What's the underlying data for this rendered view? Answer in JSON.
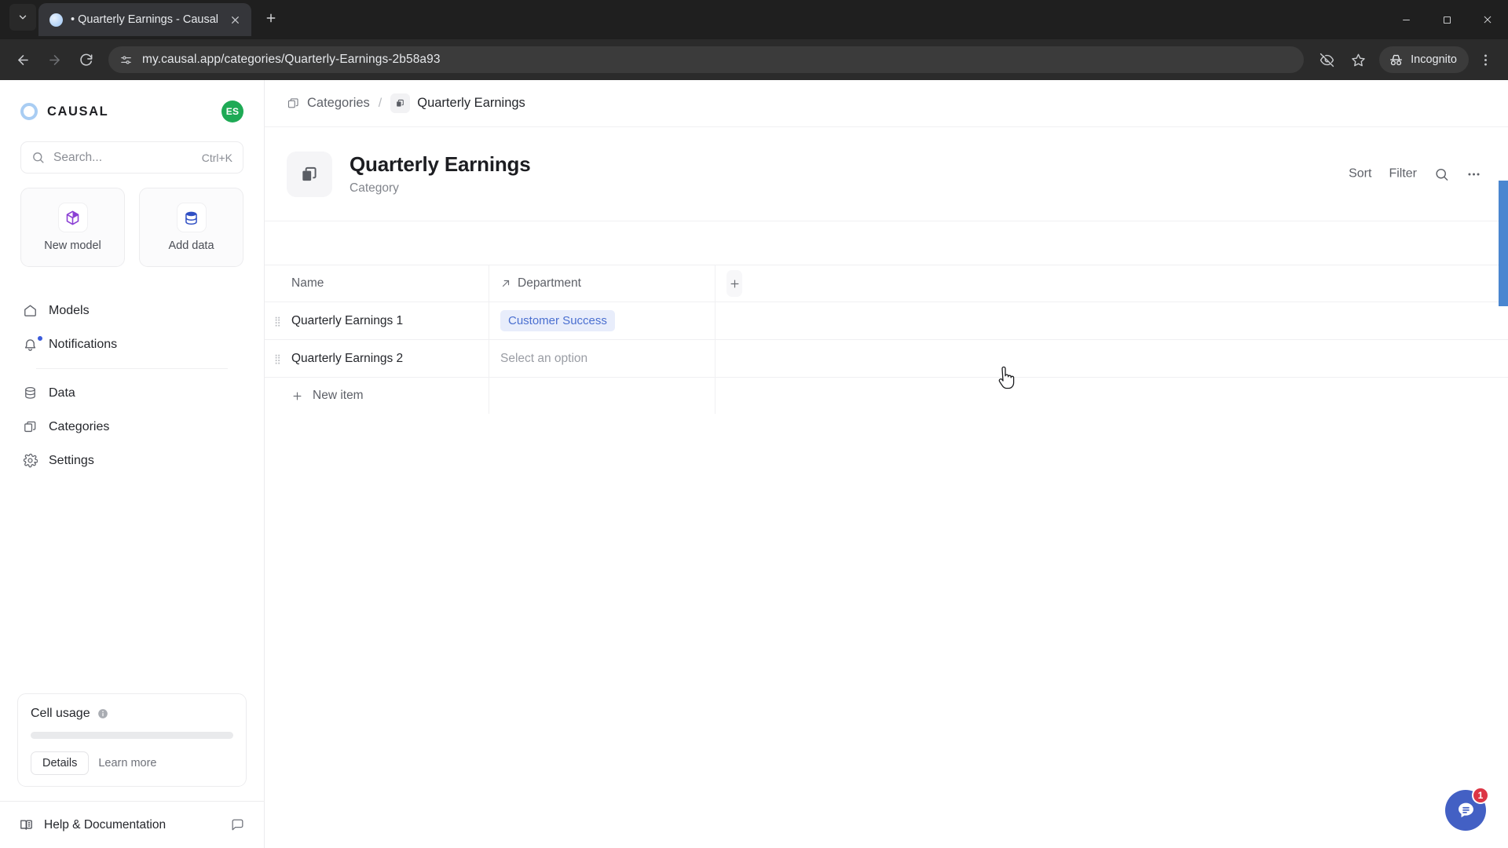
{
  "browser": {
    "tab": {
      "title": "• Quarterly Earnings - Causal",
      "close_icon": "close-icon",
      "favicon": "causal-favicon"
    },
    "new_tab_label": "+",
    "window_controls": {
      "minimize": "minimize-icon",
      "maximize": "maximize-icon",
      "close": "close-icon"
    },
    "toolbar": {
      "back_icon": "back-arrow-icon",
      "forward_icon": "forward-arrow-icon",
      "reload_icon": "reload-icon",
      "site_info_icon": "site-settings-icon",
      "url": "my.causal.app/categories/Quarterly-Earnings-2b58a93",
      "tracking_protection_icon": "eye-off-icon",
      "bookmark_icon": "star-icon",
      "incognito_label": "Incognito",
      "incognito_icon": "incognito-hat-icon",
      "menu_icon": "three-dots-vertical-icon"
    }
  },
  "sidebar": {
    "brand": {
      "name": "CAUSAL",
      "mark_icon": "causal-ring-icon"
    },
    "avatar": {
      "initials": "ES"
    },
    "search": {
      "placeholder": "Search...",
      "shortcut": "Ctrl+K",
      "icon": "search-icon"
    },
    "quick_actions": [
      {
        "label": "New model",
        "icon": "cube-icon"
      },
      {
        "label": "Add data",
        "icon": "database-icon"
      }
    ],
    "nav_primary": [
      {
        "label": "Models",
        "icon": "home-icon",
        "badge": false
      },
      {
        "label": "Notifications",
        "icon": "bell-icon",
        "badge": true
      }
    ],
    "nav_secondary": [
      {
        "label": "Data",
        "icon": "database-icon"
      },
      {
        "label": "Categories",
        "icon": "copy-icon"
      },
      {
        "label": "Settings",
        "icon": "gear-icon"
      }
    ],
    "usage": {
      "title": "Cell usage",
      "info_icon": "info-icon",
      "details_label": "Details",
      "learn_more_label": "Learn more",
      "bar_percent": 0
    },
    "footer": {
      "help_label": "Help & Documentation",
      "help_icon": "book-icon",
      "chat_icon": "chat-icon"
    }
  },
  "main": {
    "breadcrumb": {
      "root_label": "Categories",
      "root_icon": "copy-icon",
      "separator": "/",
      "current_label": "Quarterly Earnings",
      "current_icon": "category-icon"
    },
    "header": {
      "title": "Quarterly Earnings",
      "subtitle": "Category",
      "icon": "category-icon",
      "actions": [
        {
          "label": "Sort",
          "type": "text",
          "name": "sort-button"
        },
        {
          "label": "Filter",
          "type": "text",
          "name": "filter-button"
        },
        {
          "label": "",
          "type": "icon",
          "name": "search-icon"
        },
        {
          "label": "",
          "type": "icon",
          "name": "more-options-icon"
        }
      ]
    },
    "table": {
      "columns": [
        {
          "label": "Name",
          "icon": null
        },
        {
          "label": "Department",
          "icon": "link-arrow-icon"
        }
      ],
      "add_column_label": "+",
      "rows": [
        {
          "name": "Quarterly Earnings 1",
          "department": "Customer Success",
          "department_is_placeholder": false
        },
        {
          "name": "Quarterly Earnings 2",
          "department": "Select an option",
          "department_is_placeholder": true
        }
      ],
      "new_item_label": "New item",
      "new_item_icon": "plus-icon"
    },
    "chat_widget": {
      "badge_count": "1",
      "icon": "chat-bubble-icon"
    }
  },
  "colors": {
    "tag_bg": "#e8edfb",
    "tag_text": "#4a6fd0",
    "accent": "#4360c4",
    "badge": "#dc3545",
    "avatar_bg": "#1eaa55",
    "scrollbar": "#4a86d0"
  }
}
